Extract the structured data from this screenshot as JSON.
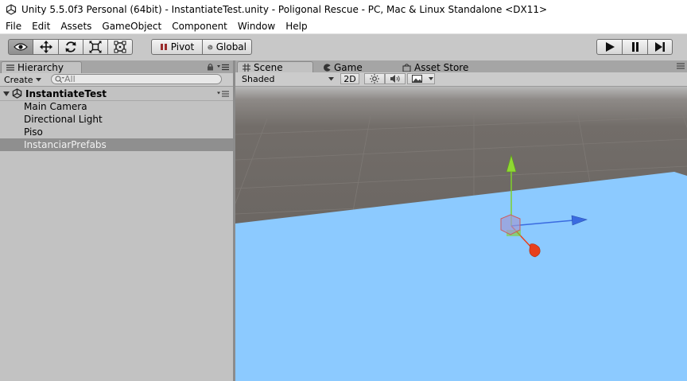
{
  "window": {
    "title": "Unity 5.5.0f3 Personal (64bit) - InstantiateTest.unity - Poligonal Rescue - PC, Mac & Linux Standalone <DX11>"
  },
  "menu": [
    "File",
    "Edit",
    "Assets",
    "GameObject",
    "Component",
    "Window",
    "Help"
  ],
  "toolbar": {
    "tools": [
      "hand-eye",
      "move",
      "rotate",
      "scale",
      "rect"
    ],
    "active_tool": "hand-eye",
    "pivot_label": "Pivot",
    "global_label": "Global",
    "playback": [
      "play",
      "pause",
      "step"
    ]
  },
  "hierarchy": {
    "tab_label": "Hierarchy",
    "create_label": "Create",
    "search_placeholder": "All",
    "scene_name": "InstantiateTest",
    "items": [
      "Main Camera",
      "Directional Light",
      "Piso",
      "InstanciarPrefabs"
    ],
    "selected_item": "InstanciarPrefabs"
  },
  "scene_view": {
    "tabs": [
      "Scene",
      "Game",
      "Asset Store"
    ],
    "active_tab": "Scene",
    "shading_mode": "Shaded",
    "mode_2d_label": "2D",
    "colors": {
      "ground_plane": "#8ccaff",
      "background": "#706b66",
      "axis_x": "#e8401c",
      "axis_y": "#7fd12a",
      "axis_z": "#3a6be0"
    }
  }
}
